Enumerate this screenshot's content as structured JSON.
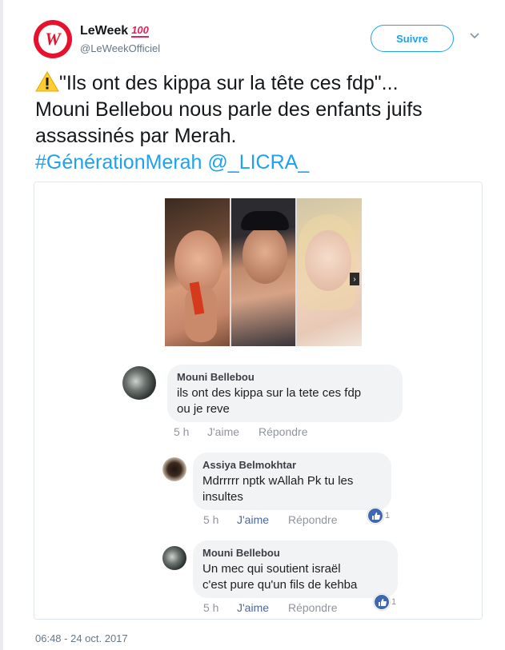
{
  "author": {
    "display_name": "LeWeek",
    "badge_emoji": "100",
    "handle": "@LeWeekOfficiel",
    "avatar_letter": "W"
  },
  "follow_label": "Suivre",
  "tweet": {
    "line1": "\"Ils ont des kippa sur la tête ces fdp\"...",
    "line2": "Mouni Bellebou nous parle des enfants juifs",
    "line3": "assassinés par Merah.",
    "hashtag": "#GénérationMerah",
    "mention": "@_LICRA_"
  },
  "comments": [
    {
      "author": "Mouni Bellebou",
      "text_line1": "ils ont des kippa sur la tete ces fdp",
      "text_line2": "ou je reve",
      "time": "5 h",
      "like": "J'aime",
      "reply": "Répondre"
    },
    {
      "author": "Assiya Belmokhtar",
      "text_line1": "Mdrrrrr nptk wAllah Pk tu les",
      "text_line2": "insultes",
      "time": "5 h",
      "like": "J'aime",
      "reply": "Répondre",
      "reactions": "1"
    },
    {
      "author": "Mouni Bellebou",
      "text_line1": "Un mec qui soutient israël",
      "text_line2": "c'est pure qu'un fils de kehba",
      "time": "5 h",
      "like": "J'aime",
      "reply": "Répondre",
      "reactions": "1"
    }
  ],
  "timestamp": "06:48 - 24 oct. 2017",
  "colors": {
    "brand_red": "#e8112d",
    "twitter_blue": "#1da1f2",
    "facebook_blue": "#4267b2"
  }
}
